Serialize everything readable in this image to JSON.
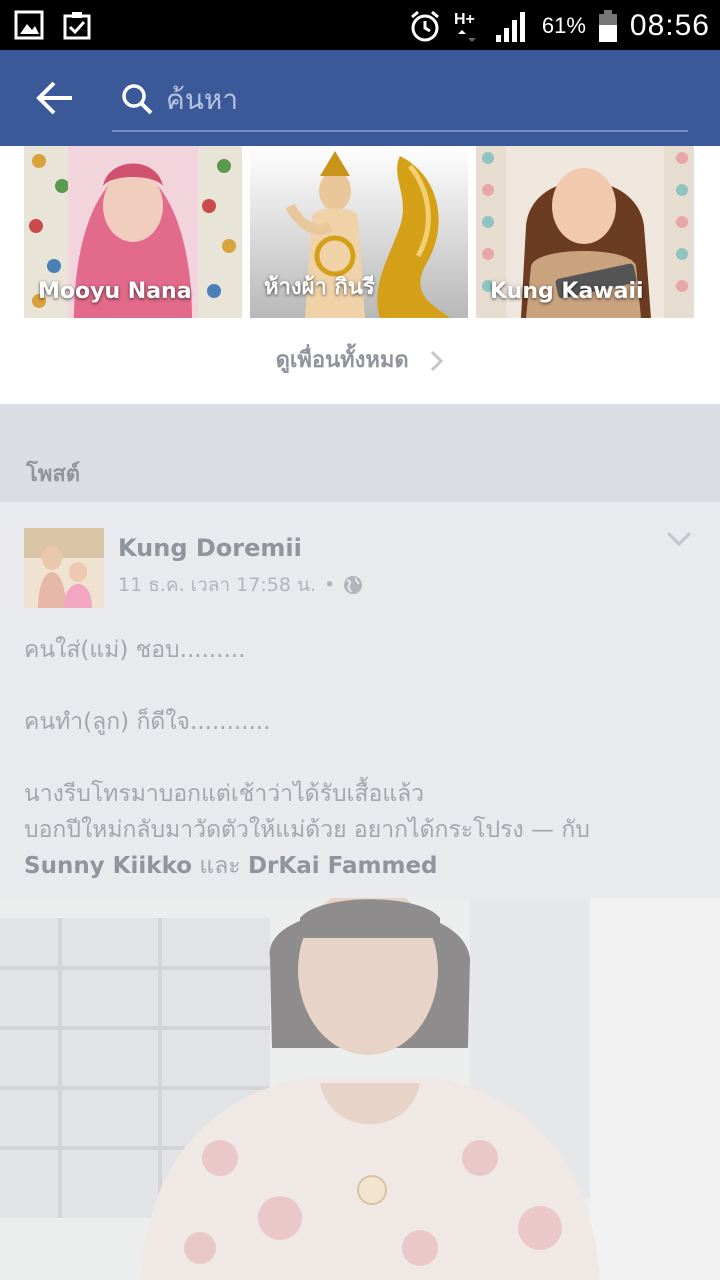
{
  "status_bar": {
    "icons": [
      "gallery-icon",
      "clipboard-check-icon",
      "alarm-icon",
      "network-hplus-icon",
      "signal-icon",
      "battery-icon"
    ],
    "battery": "61%",
    "time": "08:56",
    "network": "H+"
  },
  "app_bar": {
    "search_placeholder": "ค้นหา",
    "color": "#3b5998"
  },
  "friends": [
    {
      "name": "Mooyu Nana"
    },
    {
      "name": "ห้างผ้า กินรี"
    },
    {
      "name": "Kung Kawaii"
    }
  ],
  "see_all_label": "ดูเพื่อนทั้งหมด",
  "posts_section_title": "โพสต์",
  "post": {
    "author": "Kung Doremii",
    "timestamp": "11 ธ.ค. เวลา 17:58 น.",
    "separator": "•",
    "lines": [
      "คนใส่(แม่) ชอบ.........",
      "คนทำ(ลูก) ก็ดีใจ...........",
      "นางรีบโทรมาบอกแต่เช้าว่าได้รับเสื้อแล้ว",
      "บอกปีใหม่กลับมาวัดตัวให้แม่ด้วย อยากได้กระโปรง — กับ"
    ],
    "tagged_1": "Sunny Kiikko",
    "and_word": "และ",
    "tagged_2": "DrKai Fammed"
  }
}
